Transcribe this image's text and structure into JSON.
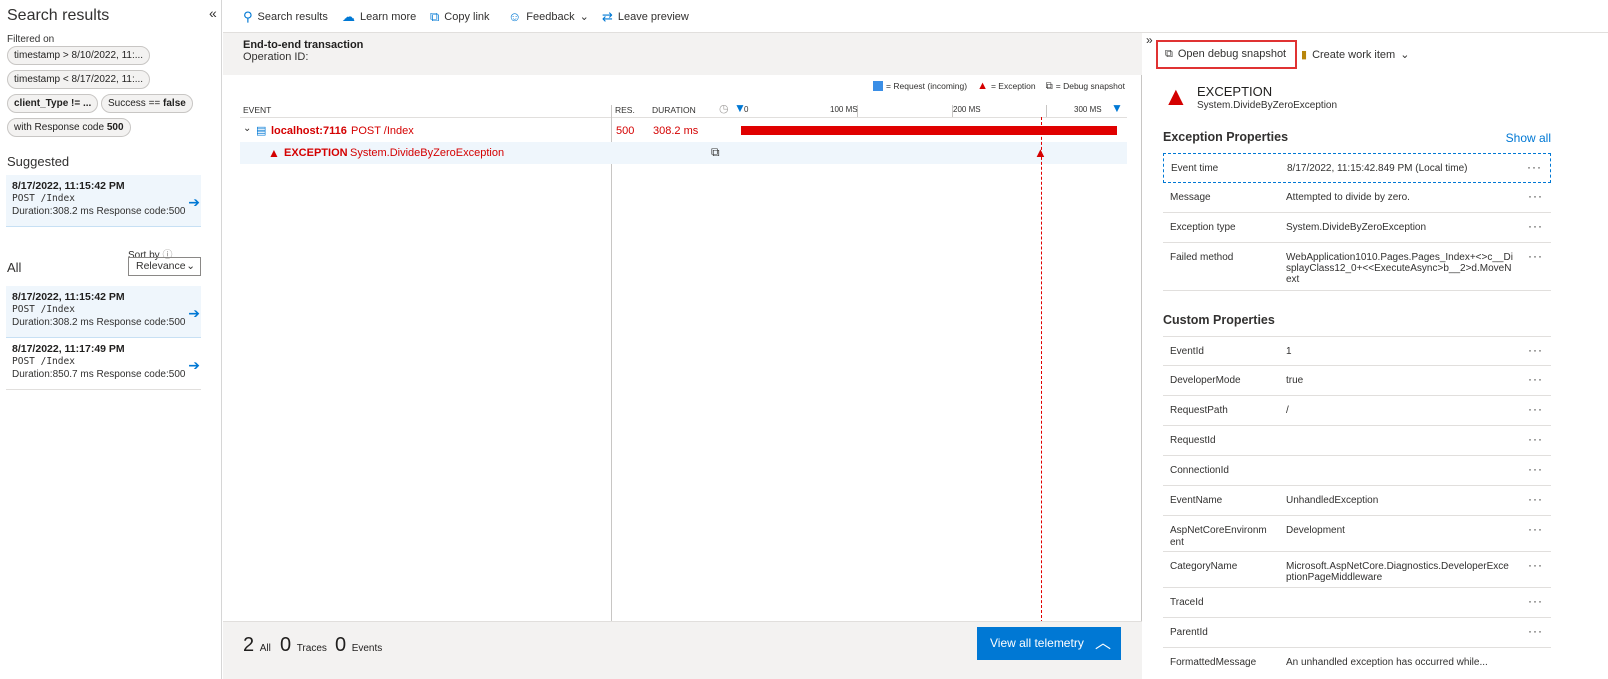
{
  "left": {
    "title": "Search results",
    "collapse_icon": "«",
    "filtered_label": "Filtered on",
    "chips": [
      "timestamp > 8/10/2022, 11:...",
      "timestamp < 8/17/2022, 11:...",
      "client_Type != ...",
      "Success == ",
      "with Response code "
    ],
    "chip_bold": [
      "false",
      "500"
    ],
    "suggested_heading": "Suggested",
    "suggested": {
      "timestamp": "8/17/2022, 11:15:42 PM",
      "request": "POST /Index",
      "duration_label": "Duration:",
      "duration": "308.2 ms",
      "code_label": "Response code:",
      "code": "500"
    },
    "all_heading": "All",
    "sort_label": "Sort by",
    "sort_value": "Relevance",
    "all_items": [
      {
        "timestamp": "8/17/2022, 11:15:42 PM",
        "request": "POST /Index",
        "duration_label": "Duration:",
        "duration": "308.2 ms",
        "code_label": "Response code:",
        "code": "500"
      },
      {
        "timestamp": "8/17/2022, 11:17:49 PM",
        "request": "POST /Index",
        "duration_label": "Duration:",
        "duration": "850.7 ms",
        "code_label": "Response code:",
        "code": "500"
      }
    ]
  },
  "toolbar": {
    "search": "Search results",
    "learn": "Learn more",
    "copy": "Copy link",
    "feedback": "Feedback",
    "leave": "Leave preview"
  },
  "transaction": {
    "title": "End-to-end transaction",
    "operation_label": "Operation ID:",
    "legend": {
      "request": "= Request (incoming)",
      "exception": "= Exception",
      "snapshot": "= Debug snapshot"
    },
    "columns": {
      "event": "EVENT",
      "res": "RES.",
      "duration": "DURATION"
    },
    "ticks": [
      "0",
      "100 MS",
      "200 MS",
      "300 MS"
    ],
    "row1": {
      "host": "localhost:7116",
      "method": "POST /Index",
      "res": "500",
      "duration": "308.2 ms"
    },
    "row2": {
      "type": "EXCEPTION",
      "name": "System.DivideByZeroException"
    },
    "footer": {
      "all_count": "2",
      "all_label": "All",
      "traces_count": "0",
      "traces_label": "Traces",
      "events_count": "0",
      "events_label": "Events",
      "view_all": "View all telemetry"
    }
  },
  "detail": {
    "open_debug": "Open debug snapshot",
    "create_work": "Create work item",
    "exc_title": "EXCEPTION",
    "exc_sub": "System.DivideByZeroException",
    "exception_props_heading": "Exception Properties",
    "show_all": "Show all",
    "exception_props": [
      {
        "k": "Event time",
        "v": "8/17/2022, 11:15:42.849 PM (Local time)"
      },
      {
        "k": "Message",
        "v": "Attempted to divide by zero."
      },
      {
        "k": "Exception type",
        "v": "System.DivideByZeroException"
      },
      {
        "k": "Failed method",
        "v": "WebApplication1010.Pages.Pages_Index+<>c__DisplayClass12_0+<<ExecuteAsync>b__2>d.MoveNext"
      }
    ],
    "custom_props_heading": "Custom Properties",
    "custom_props": [
      {
        "k": "EventId",
        "v": "1"
      },
      {
        "k": "DeveloperMode",
        "v": "true"
      },
      {
        "k": "RequestPath",
        "v": "/"
      },
      {
        "k": "RequestId",
        "v": ""
      },
      {
        "k": "ConnectionId",
        "v": ""
      },
      {
        "k": "EventName",
        "v": "UnhandledException"
      },
      {
        "k": "AspNetCoreEnvironment",
        "v": "Development"
      },
      {
        "k": "CategoryName",
        "v": "Microsoft.AspNetCore.Diagnostics.DeveloperExceptionPageMiddleware"
      },
      {
        "k": "TraceId",
        "v": ""
      },
      {
        "k": "ParentId",
        "v": ""
      },
      {
        "k": "FormattedMessage",
        "v": "An unhandled exception has occurred while..."
      }
    ],
    "more": "···"
  }
}
